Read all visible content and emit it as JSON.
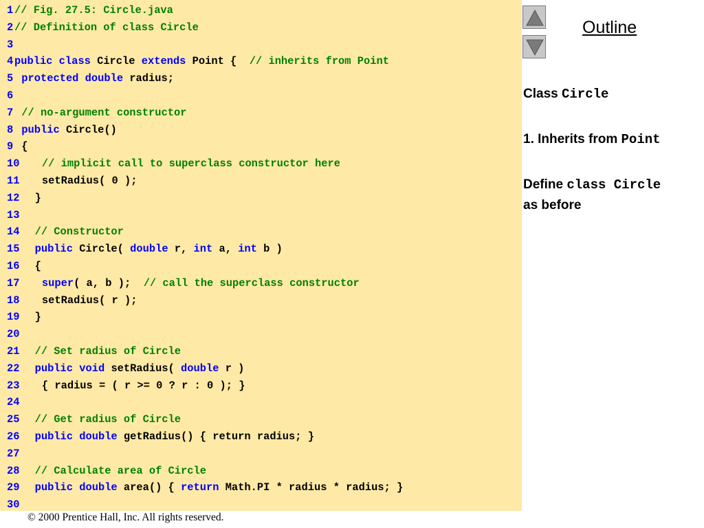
{
  "code": {
    "title_comment": "// Fig. 27.5: Circle.java",
    "lines": [
      {
        "num": "1",
        "tokens": [
          {
            "t": "cm",
            "v": "// Fig. 27.5: Circle.java"
          }
        ]
      },
      {
        "num": "2",
        "tokens": [
          {
            "t": "cm",
            "v": "// Definition of class Circle"
          }
        ]
      },
      {
        "num": "3",
        "tokens": []
      },
      {
        "num": "4",
        "tokens": [
          {
            "t": "kw",
            "v": "public class "
          },
          {
            "t": "pl",
            "v": "Circle "
          },
          {
            "t": "kw",
            "v": "extends "
          },
          {
            "t": "pl",
            "v": "Point {  "
          },
          {
            "t": "cm",
            "v": "// inherits from Point"
          }
        ]
      },
      {
        "num": "5",
        "tokens": [
          {
            "t": "kw",
            "v": "protected double "
          },
          {
            "t": "pl",
            "v": "radius;"
          }
        ]
      },
      {
        "num": "6",
        "tokens": []
      },
      {
        "num": "7",
        "tokens": [
          {
            "t": "cm",
            "v": "// no-argument constructor"
          }
        ]
      },
      {
        "num": "8",
        "tokens": [
          {
            "t": "kw",
            "v": "public "
          },
          {
            "t": "pl",
            "v": "Circle()"
          }
        ]
      },
      {
        "num": "9",
        "tokens": [
          {
            "t": "pl",
            "v": "{"
          }
        ]
      },
      {
        "num": "10",
        "tokens": [
          {
            "t": "cm",
            "v": "// implicit call to superclass constructor here"
          }
        ]
      },
      {
        "num": "11",
        "tokens": [
          {
            "t": "pl",
            "v": "setRadius( 0 );"
          }
        ]
      },
      {
        "num": "12",
        "tokens": [
          {
            "t": "pl",
            "v": "}"
          }
        ]
      },
      {
        "num": "13",
        "tokens": []
      },
      {
        "num": "14",
        "tokens": [
          {
            "t": "cm",
            "v": "// Constructor"
          }
        ]
      },
      {
        "num": "15",
        "tokens": [
          {
            "t": "kw",
            "v": "public "
          },
          {
            "t": "pl",
            "v": "Circle( "
          },
          {
            "t": "kw",
            "v": "double "
          },
          {
            "t": "pl",
            "v": "r, "
          },
          {
            "t": "kw",
            "v": "int "
          },
          {
            "t": "pl",
            "v": "a, "
          },
          {
            "t": "kw",
            "v": "int "
          },
          {
            "t": "pl",
            "v": "b )"
          }
        ]
      },
      {
        "num": "16",
        "tokens": [
          {
            "t": "pl",
            "v": "{"
          }
        ]
      },
      {
        "num": "17",
        "tokens": [
          {
            "t": "kw",
            "v": "super"
          },
          {
            "t": "pl",
            "v": "( a, b );  "
          },
          {
            "t": "cm",
            "v": "// call the superclass constructor"
          }
        ]
      },
      {
        "num": "18",
        "tokens": [
          {
            "t": "pl",
            "v": "setRadius( r );"
          }
        ]
      },
      {
        "num": "19",
        "tokens": [
          {
            "t": "pl",
            "v": "}"
          }
        ]
      },
      {
        "num": "20",
        "tokens": []
      },
      {
        "num": "21",
        "tokens": [
          {
            "t": "cm",
            "v": "// Set radius of Circle"
          }
        ]
      },
      {
        "num": "22",
        "tokens": [
          {
            "t": "kw",
            "v": "public void "
          },
          {
            "t": "pl",
            "v": "setRadius( "
          },
          {
            "t": "kw",
            "v": "double "
          },
          {
            "t": "pl",
            "v": "r )"
          }
        ]
      },
      {
        "num": "23",
        "tokens": [
          {
            "t": "pl",
            "v": "{ radius = ( r >= 0 ? r : 0 ); }"
          }
        ]
      },
      {
        "num": "24",
        "tokens": []
      },
      {
        "num": "25",
        "tokens": [
          {
            "t": "cm",
            "v": "// Get radius of Circle"
          }
        ]
      },
      {
        "num": "26",
        "tokens": [
          {
            "t": "kw",
            "v": "public double "
          },
          {
            "t": "pl",
            "v": "getRadius() { return radius; }"
          }
        ]
      },
      {
        "num": "27",
        "tokens": []
      },
      {
        "num": "28",
        "tokens": [
          {
            "t": "cm",
            "v": "// Calculate area of Circle"
          }
        ]
      },
      {
        "num": "29",
        "tokens": [
          {
            "t": "kw",
            "v": "public double "
          },
          {
            "t": "pl",
            "v": "area() { "
          },
          {
            "t": "kw",
            "v": "return "
          },
          {
            "t": "pl",
            "v": "Math.PI * radius * radius; }"
          }
        ]
      },
      {
        "num": "30",
        "tokens": []
      }
    ]
  },
  "nav": {
    "up_icon": "triangle-up-icon",
    "down_icon": "triangle-down-icon",
    "outline_label": "Outline"
  },
  "sidebar": {
    "heading_text": "Class ",
    "heading_code": "Circle",
    "item1_text": "1. Inherits from ",
    "item1_code": "Point",
    "item2_text": "Define ",
    "item2_code": "class Circle",
    "item2_tail": "as before"
  },
  "footer": {
    "copyright": "© 2000 Prentice Hall, Inc.  All rights reserved."
  },
  "colors": {
    "code_background": "#ffe9a6",
    "keyword": "#0000ff",
    "comment": "#008000",
    "line_number": "#0000ff"
  }
}
